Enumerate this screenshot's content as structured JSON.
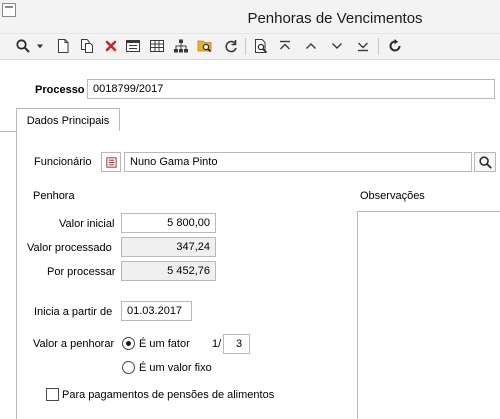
{
  "window": {
    "title": "Penhoras de Vencimentos"
  },
  "toolbar": {
    "icons": [
      "search-icon",
      "dropdown-arrow-icon",
      "new-document-icon",
      "copy-icon",
      "delete-icon",
      "form-view-icon",
      "grid-view-icon",
      "tree-view-icon",
      "search-folder-icon",
      "refresh-icon",
      "print-preview-icon",
      "first-record-icon",
      "previous-record-icon",
      "next-record-icon",
      "last-record-icon",
      "reload-icon"
    ],
    "accent_delete": "#c0282d",
    "accent_folder": "#e8b12a"
  },
  "processo": {
    "label": "Processo",
    "value": "0018799/2017"
  },
  "tabs": [
    {
      "label": "Dados Principais",
      "active": true
    }
  ],
  "funcionario": {
    "label": "Funcionário",
    "value": "Nuno Gama Pinto"
  },
  "penhora": {
    "section_label": "Penhora",
    "valor_inicial": {
      "label": "Valor inicial",
      "value": "5 800,00"
    },
    "valor_processado": {
      "label": "Valor processado",
      "value": "347,24"
    },
    "por_processar": {
      "label": "Por processar",
      "value": "5 452,76"
    },
    "inicia": {
      "label": "Inicia a partir de",
      "value": "01.03.2017"
    },
    "valor_a_penhorar": {
      "label": "Valor a penhorar",
      "option_fator": "É um fator",
      "option_fixo": "É um valor fixo",
      "selected": "É um fator",
      "fator_prefix": "1/",
      "fator_value": "3"
    },
    "pensoes": {
      "label": "Para pagamentos de pensões de alimentos",
      "checked": false
    }
  },
  "observacoes": {
    "label": "Observações",
    "value": ""
  }
}
